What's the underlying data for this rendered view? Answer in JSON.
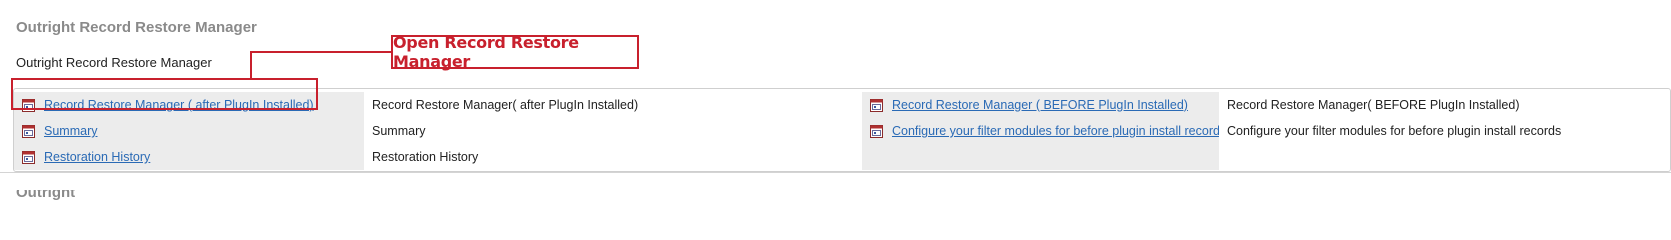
{
  "section": {
    "title": "Outright Record Restore Manager",
    "subtitle": "Outright Record Restore Manager"
  },
  "rows": [
    {
      "left_link": "Record Restore Manager ( after PlugIn Installed)",
      "left_desc": "Record Restore Manager( after PlugIn Installed)",
      "right_link": "Record Restore Manager ( BEFORE PlugIn Installed)",
      "right_desc": "Record Restore Manager( BEFORE PlugIn Installed)"
    },
    {
      "left_link": "Summary",
      "left_desc": "Summary",
      "right_link": "Configure your filter modules for before plugin install records",
      "right_desc": "Configure your filter modules for before plugin install records"
    },
    {
      "left_link": "Restoration History",
      "left_desc": "Restoration History",
      "right_link": "",
      "right_desc": ""
    }
  ],
  "callout": {
    "label": "Open Record Restore Manager",
    "color": "#c8202d"
  },
  "next_section": {
    "title_fragment": "Outright Leasemarlifornan"
  },
  "colors": {
    "link": "#2a6ab5",
    "title_gray": "#8a8a8a",
    "row_shade": "#ececec"
  },
  "icons": {
    "module": "module-admin-icon"
  }
}
